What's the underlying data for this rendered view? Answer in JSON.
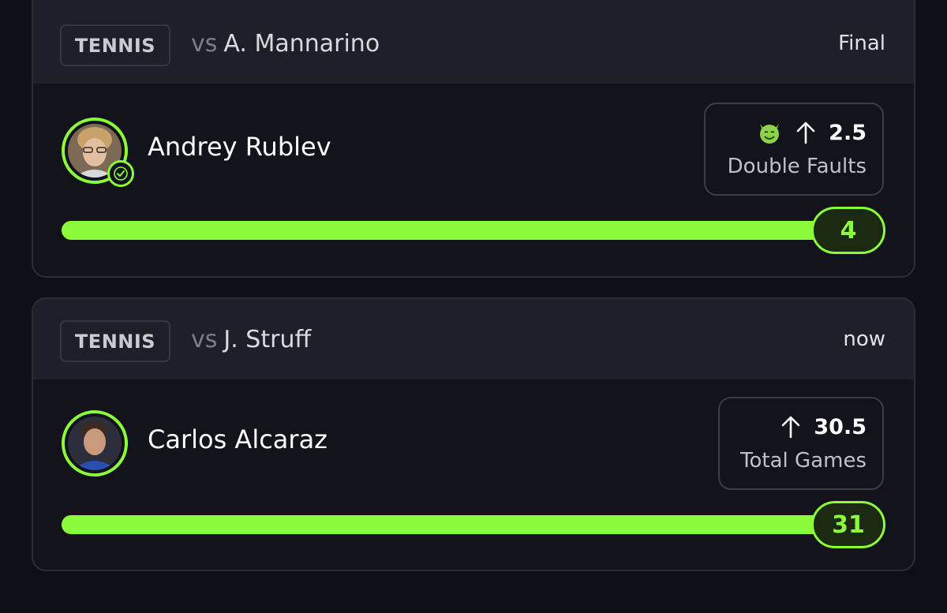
{
  "picks": [
    {
      "sport": "TENNIS",
      "vs_prefix": "vs",
      "opponent": "A. Mannarino",
      "status": "Final",
      "player": "Andrey Rublev",
      "player_avatar_icon": "player-photo",
      "badge_icon": "check-icon",
      "emoji_icon": "devil-emoji-icon",
      "direction_icon": "arrow-up-icon",
      "line_value": "2.5",
      "stat_label": "Double Faults",
      "result_value": "4",
      "progress_fraction": 1.0,
      "accent_color": "#8cfb3a"
    },
    {
      "sport": "TENNIS",
      "vs_prefix": "vs",
      "opponent": "J. Struff",
      "status": "now",
      "player": "Carlos Alcaraz",
      "player_avatar_icon": "player-photo",
      "direction_icon": "arrow-up-icon",
      "line_value": "30.5",
      "stat_label": "Total Games",
      "result_value": "31",
      "progress_fraction": 1.0,
      "accent_color": "#8cfb3a"
    }
  ]
}
